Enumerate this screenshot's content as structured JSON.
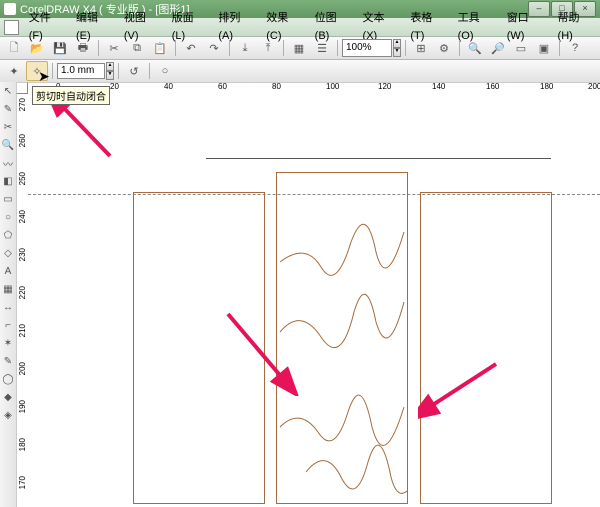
{
  "app": {
    "title": "CorelDRAW X4 ( 专业版 ) - [图形1]"
  },
  "menu": {
    "file": "文件(F)",
    "edit": "编辑(E)",
    "view": "视图(V)",
    "layout": "版面(L)",
    "arrange": "排列(A)",
    "effects": "效果(C)",
    "bitmaps": "位图(B)",
    "text": "文本(X)",
    "table": "表格(T)",
    "tools": "工具(O)",
    "window": "窗口(W)",
    "help": "帮助(H)"
  },
  "toolbar1": {
    "zoom": "100%"
  },
  "toolbar2": {
    "stroke": "1.0 mm"
  },
  "tooltip": "剪切时自动闭合",
  "ruler_h": [
    "0",
    "20",
    "40",
    "60",
    "80",
    "100",
    "120",
    "140",
    "160",
    "180",
    "200"
  ],
  "ruler_v": [
    "270",
    "260",
    "250",
    "240",
    "230",
    "220",
    "210",
    "200",
    "190",
    "180",
    "170",
    "160"
  ],
  "colors": {
    "object": "#a56b3a",
    "arrow": "#e6125a"
  }
}
